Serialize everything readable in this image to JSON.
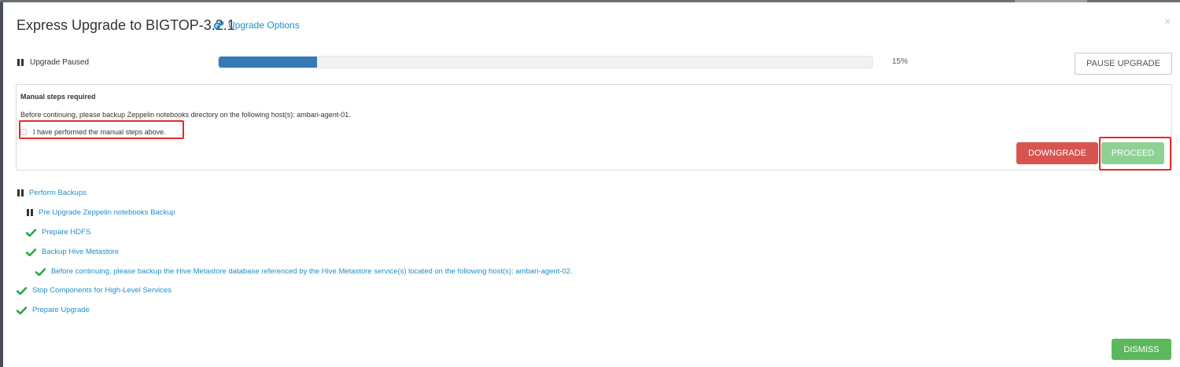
{
  "modal": {
    "title": "Express Upgrade to BIGTOP-3.2.1",
    "options_link": "Upgrade Options",
    "close_glyph": "×"
  },
  "status": {
    "state_text": "Upgrade Paused",
    "progress_percent": 15,
    "percent_label": "15%",
    "pause_button": "PAUSE UPGRADE",
    "progress_color": "#337ab7"
  },
  "manual_steps": {
    "title": "Manual steps required",
    "message": "Before continuing, please backup Zeppelin notebooks directory on the following host(s): ambari-agent-01.",
    "checkbox_label": "I have performed the manual steps above.",
    "checkbox_checked": false,
    "downgrade_button": "DOWNGRADE",
    "proceed_button": "PROCEED"
  },
  "steps": [
    {
      "label": "Perform Backups",
      "status": "paused",
      "icon": "pause-icon"
    },
    {
      "label": "Pre Upgrade Zeppelin notebooks Backup",
      "status": "paused",
      "icon": "pause-icon"
    },
    {
      "label": "Prepare HDFS",
      "status": "completed",
      "icon": "check-icon"
    },
    {
      "label": "Backup Hive Metastore",
      "status": "completed",
      "icon": "check-icon"
    },
    {
      "label": "Before continuing, please backup the Hive Metastore database referenced by the Hive Metastore service(s) located on the following host(s): ambari-agent-02.",
      "status": "completed",
      "icon": "check-icon"
    },
    {
      "label": "Stop Components for High-Level Services",
      "status": "completed",
      "icon": "check-icon"
    },
    {
      "label": "Prepare Upgrade",
      "status": "completed",
      "icon": "check-icon"
    }
  ],
  "footer": {
    "dismiss_button": "DISMISS"
  },
  "colors": {
    "link": "#1f8fc9",
    "success": "#5cb85c",
    "danger": "#d9534f",
    "proceed_disabled": "#8fd194",
    "highlight": "#e32b2b"
  }
}
